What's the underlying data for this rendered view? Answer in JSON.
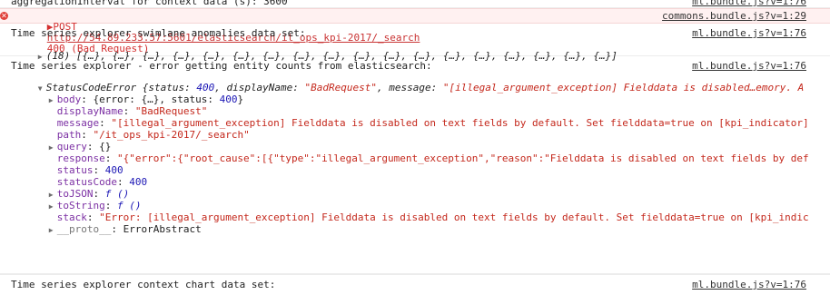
{
  "top_line": "aggregationInterval for context data (s): 3600",
  "top_source": "ml.bundle.js?v=1:76",
  "post_error": {
    "method": "▶POST",
    "url": "http://54.89.233.57:5601/elasticsearch/it_ops_kpi-2017/_search",
    "status": "400 (Bad Request)",
    "source": "commons.bundle.js?v=1:29"
  },
  "swimlane": {
    "title": "Time series explorer swimlane anomalies data set:",
    "source": "ml.bundle.js?v=1:76",
    "array_line": "(18) [{…}, {…}, {…}, {…}, {…}, {…}, {…}, {…}, {…}, {…}, {…}, {…}, {…}, {…}, {…}, {…}, {…}, {…}]"
  },
  "entity_error": {
    "title": "Time series explorer - error getting entity counts from elasticsearch:",
    "source": "ml.bundle.js?v=1:76",
    "summary_prefix": "StatusCodeError {status: ",
    "summary_status": "400",
    "summary_mid": ", displayName: ",
    "summary_display": "\"BadRequest\"",
    "summary_mid2": ", message: ",
    "summary_message": "\"[illegal_argument_exception] Fieldd​ata is disabled…emory. A",
    "body_key": "body",
    "body_val_pre": ": {error: {…}, status: ",
    "body_status": "400",
    "body_val_post": "}",
    "displayName_key": "displayName",
    "displayName_val": "\"BadRequest\"",
    "message_key": "message",
    "message_val": "\"[illegal_argument_exception] Fielddata is disabled on text fields by default. Set fielddata=true on [kpi_indicator]",
    "path_key": "path",
    "path_val": "\"/it_ops_kpi-2017/_search\"",
    "query_key": "query",
    "query_val": ": {}",
    "response_key": "response",
    "response_val": "\"{\"error\":{\"root_cause\":[{\"type\":\"illegal_argument_exception\",\"reason\":\"Fielddata is disabled on text fields by def",
    "status_key": "status",
    "status_val": "400",
    "statusCode_key": "statusCode",
    "statusCode_val": "400",
    "toJSON_key": "toJSON",
    "toJSON_val": "f ()",
    "toString_key": "toString",
    "toString_val": "f ()",
    "stack_key": "stack",
    "stack_val": "\"Error: [illegal_argument_exception] Fielddata is disabled on text fields by default. Set fielddata=true on [kpi_indic",
    "proto_key": "__proto__",
    "proto_val": ": ErrorAbstract"
  },
  "context_chart": {
    "title": "Time series explorer context chart data set:",
    "source": "ml.bundle.js?v=1:76"
  },
  "colors": {
    "error_bg": "#fff1f1",
    "error_text": "#d42f2f",
    "key_purple": "#7b2fa3",
    "string_red": "#c4281c",
    "number_blue": "#1c17b5"
  }
}
